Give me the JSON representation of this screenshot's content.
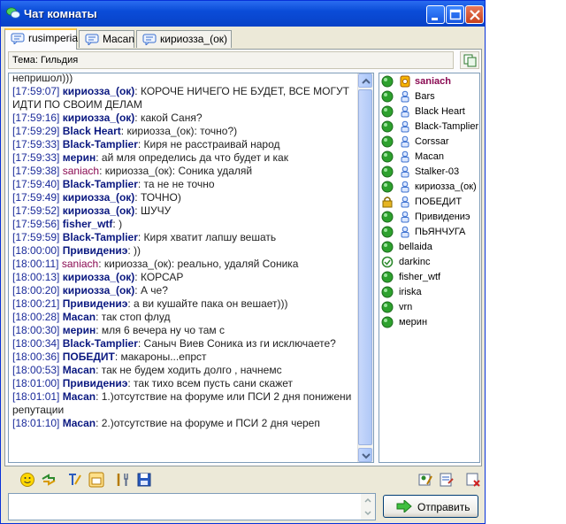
{
  "window": {
    "title": "Чат комнаты",
    "buttons": [
      "minimize",
      "maximize",
      "close"
    ]
  },
  "tabs": [
    {
      "label": "rusimperia",
      "active": true
    },
    {
      "label": "Macan",
      "active": false
    },
    {
      "label": "кириозза_(ок)",
      "active": false
    }
  ],
  "topic": {
    "text": "Тема: Гильдия"
  },
  "messages": [
    {
      "time": "",
      "nick": "",
      "text": "непришол)))"
    },
    {
      "time": "[17:59:07]",
      "nick": "кириозза_(ок)",
      "text": ": КОРОЧЕ НИЧЕГО НЕ БУДЕТ, ВСЕ МОГУТ ИДТИ ПО СВОИМ ДЕЛАМ"
    },
    {
      "time": "[17:59:16]",
      "nick": "кириозза_(ок)",
      "text": ": какой Саня?"
    },
    {
      "time": "[17:59:29]",
      "nick": "Black Heart",
      "text": ": кириозза_(ок): точно?)"
    },
    {
      "time": "[17:59:33]",
      "nick": "Black-Tamplier",
      "text": ": Киря не расстраивай народ"
    },
    {
      "time": "[17:59:33]",
      "nick": "мерин",
      "text": ": ай мля определись да что будет и как"
    },
    {
      "time": "[17:59:38]",
      "nick": "saniach",
      "text": ": кириозза_(ок): Соника удаляй",
      "pink": true
    },
    {
      "time": "[17:59:40]",
      "nick": "Black-Tamplier",
      "text": ": та не не точно"
    },
    {
      "time": "[17:59:49]",
      "nick": "кириозза_(ок)",
      "text": ": ТОЧНО)"
    },
    {
      "time": "[17:59:52]",
      "nick": "кириозза_(ок)",
      "text": ": ШУЧУ"
    },
    {
      "time": "[17:59:56]",
      "nick": "fisher_wtf",
      "text": ": )"
    },
    {
      "time": "[17:59:59]",
      "nick": "Black-Tamplier",
      "text": ": Киря хватит лапшу вешать"
    },
    {
      "time": "[18:00:00]",
      "nick": "Привидениэ",
      "text": ": ))"
    },
    {
      "time": "[18:00:11]",
      "nick": "saniach",
      "text": ": кириозза_(ок): реально, удаляй Соника",
      "pink": true
    },
    {
      "time": "[18:00:13]",
      "nick": "кириозза_(ок)",
      "text": ": КОРСАР"
    },
    {
      "time": "[18:00:20]",
      "nick": "кириозза_(ок)",
      "text": ": А че?"
    },
    {
      "time": "[18:00:21]",
      "nick": "Привидениэ",
      "text": ": а ви кушайте пака он вешает)))"
    },
    {
      "time": "[18:00:28]",
      "nick": "Macan",
      "text": ": так стоп флуд"
    },
    {
      "time": "[18:00:30]",
      "nick": "мерин",
      "text": ": мля  6 вечера ну чо там с"
    },
    {
      "time": "[18:00:34]",
      "nick": "Black-Tamplier",
      "text": ": Саныч Виев Соника из ги исключаете?"
    },
    {
      "time": "[18:00:36]",
      "nick": "ПОБЕДИТ",
      "text": ": макароны...епрст"
    },
    {
      "time": "[18:00:53]",
      "nick": "Macan",
      "text": ": так не будем ходить долго , начнемс"
    },
    {
      "time": "[18:01:00]",
      "nick": "Привидениэ",
      "text": ": так тихо всем пусть сани скажет"
    },
    {
      "time": "[18:01:01]",
      "nick": "Macan",
      "text": ": 1.)отсутствие на форуме или ПСИ 2 дня понижени репутации"
    },
    {
      "time": "[18:01:10]",
      "nick": "Macan",
      "text": ": 2.)отсутствие на форуме и ПСИ 2 дня череп"
    }
  ],
  "users": [
    {
      "name": "saniach",
      "role": "owner",
      "status": "online",
      "highlight": true
    },
    {
      "name": "Bars",
      "role": "moderator",
      "status": "online"
    },
    {
      "name": "Black Heart",
      "role": "moderator",
      "status": "online"
    },
    {
      "name": "Black-Tamplier",
      "role": "moderator",
      "status": "online"
    },
    {
      "name": "Corssar",
      "role": "moderator",
      "status": "online"
    },
    {
      "name": "Macan",
      "role": "moderator",
      "status": "online"
    },
    {
      "name": "Stalker-03",
      "role": "moderator",
      "status": "online"
    },
    {
      "name": "кириозза_(ок)",
      "role": "moderator",
      "status": "online"
    },
    {
      "name": "ПОБЕДИТ",
      "role": "moderator",
      "status": "locked"
    },
    {
      "name": "Привидениэ",
      "role": "moderator",
      "status": "online"
    },
    {
      "name": "ПЬЯНЧУГА",
      "role": "moderator",
      "status": "online"
    },
    {
      "name": "bellaida",
      "role": "",
      "status": "online"
    },
    {
      "name": "darkinc",
      "role": "",
      "status": "away"
    },
    {
      "name": "fisher_wtf",
      "role": "",
      "status": "online"
    },
    {
      "name": "iriska",
      "role": "",
      "status": "online"
    },
    {
      "name": "vrn",
      "role": "",
      "status": "online"
    },
    {
      "name": "мерин",
      "role": "",
      "status": "online"
    }
  ],
  "toolbar": {
    "left_icons": [
      "smiley-icon",
      "refresh-icon",
      "font-icon",
      "window-icon",
      "tools-icon",
      "save-icon"
    ],
    "right_icons": [
      "user-edit-icon",
      "note-icon",
      "delete-icon"
    ]
  },
  "input": {
    "value": ""
  },
  "send_button": {
    "label": "Отправить"
  },
  "colors": {
    "title_bar": "#0a4cd8",
    "timestamp": "#1a2a9a",
    "nick": "#0a1880",
    "nick_owner": "#8a0a52",
    "status_online": "#2ea12e",
    "role_icon": "#5a8ad8"
  }
}
